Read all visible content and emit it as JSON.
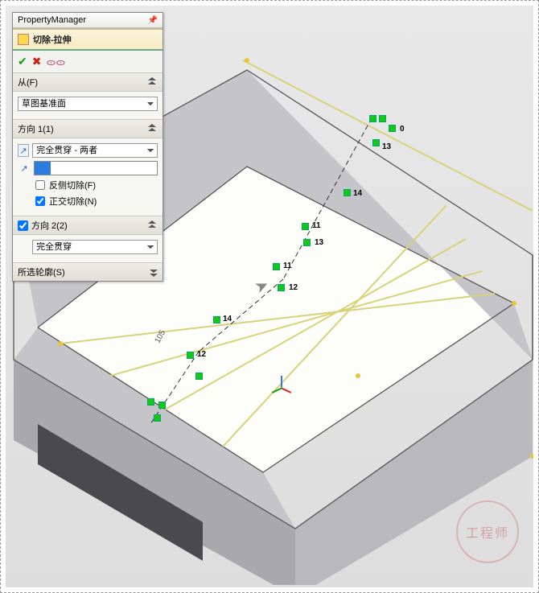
{
  "header": {
    "title": "PropertyManager"
  },
  "feature": {
    "name": "切除-拉伸"
  },
  "confirm": {
    "ok": "✔",
    "cancel": "✖",
    "preview": "👓"
  },
  "sections": {
    "from": {
      "title": "从(F)",
      "plane": "草图基准面"
    },
    "dir1": {
      "title": "方向 1(1)",
      "end_condition": "完全贯穿 - 两者",
      "flip_side_label": "反侧切除(F)",
      "flip_side_checked": false,
      "normal_cut_label": "正交切除(N)",
      "normal_cut_checked": true
    },
    "dir2": {
      "title": "方向 2(2)",
      "enabled": true,
      "end_condition": "完全贯穿"
    },
    "contours": {
      "title": "所选轮廓(S)"
    }
  },
  "scene": {
    "dimension_label": "105",
    "node_labels": [
      "13",
      "0",
      "11",
      "14",
      "13",
      "11",
      "12",
      "14",
      "12"
    ],
    "watermark_text": "工程师"
  }
}
